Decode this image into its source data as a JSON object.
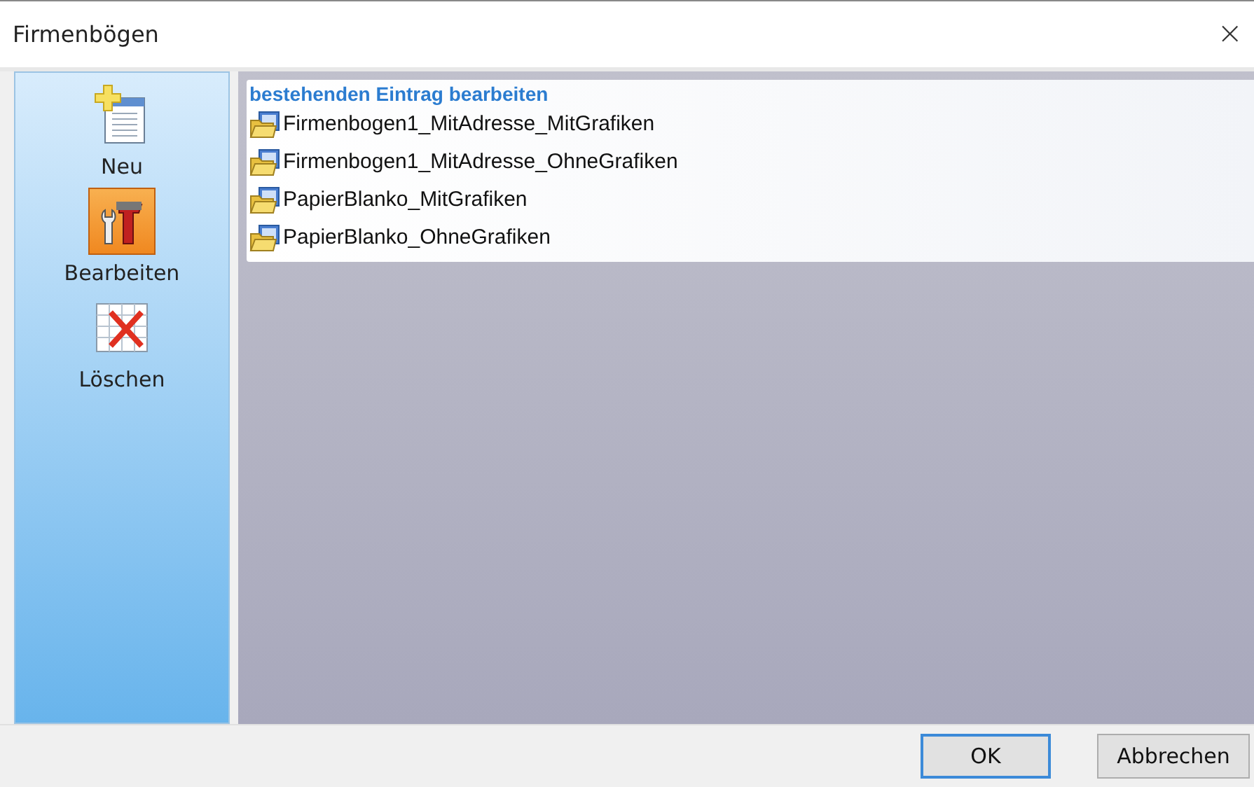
{
  "window": {
    "title": "Firmenbögen",
    "close": "×"
  },
  "sidebar": {
    "items": [
      {
        "label": "Neu",
        "kind": "new",
        "selected": false
      },
      {
        "label": "Bearbeiten",
        "kind": "edit",
        "selected": true
      },
      {
        "label": "Löschen",
        "kind": "delete",
        "selected": false
      }
    ]
  },
  "list": {
    "heading": "bestehenden Eintrag bearbeiten",
    "items": [
      {
        "label": "Firmenbogen1_MitAdresse_MitGrafiken"
      },
      {
        "label": "Firmenbogen1_MitAdresse_OhneGrafiken"
      },
      {
        "label": "PapierBlanko_MitGrafiken"
      },
      {
        "label": "PapierBlanko_OhneGrafiken"
      }
    ]
  },
  "buttons": [
    {
      "label": "OK",
      "default": true
    },
    {
      "label": "Abbrechen",
      "default": false
    }
  ]
}
